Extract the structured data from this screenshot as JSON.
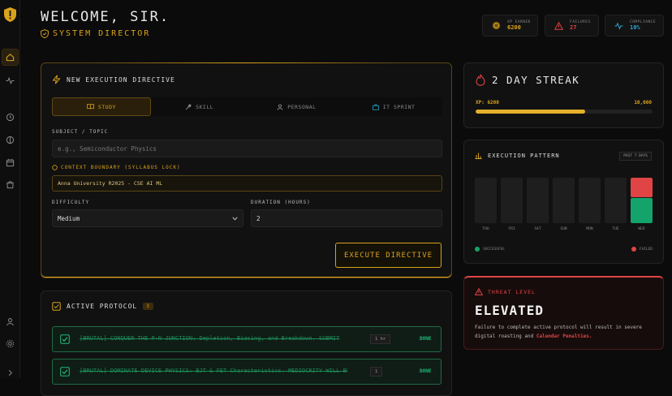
{
  "header": {
    "title": "WELCOME, SIR.",
    "subtitle": "SYSTEM DIRECTOR"
  },
  "stats": [
    {
      "label": "XP EARNED",
      "value": "6200",
      "color": "#d9a21b",
      "icon": "coin-icon"
    },
    {
      "label": "FAILURES",
      "value": "27",
      "color": "#e04444",
      "icon": "warning-icon"
    },
    {
      "label": "COMPLIANCE",
      "value": "10%",
      "color": "#2aa6c9",
      "icon": "pulse-icon"
    }
  ],
  "directive": {
    "title": "NEW EXECUTION DIRECTIVE",
    "tabs": [
      "STUDY",
      "SKILL",
      "PERSONAL",
      "IT SPRINT"
    ],
    "active_tab": "STUDY",
    "subject_label": "SUBJECT / TOPIC",
    "subject_placeholder": "e.g., Semiconductor Physics",
    "boundary_label": "CONTEXT BOUNDARY (SYLLABUS LOCK)",
    "boundary_value": "Anna University R2025 - CSE AI ML",
    "difficulty_label": "DIFFICULTY",
    "difficulty_value": "Medium",
    "duration_label": "DURATION (HOURS)",
    "duration_value": "2",
    "execute_label": "EXECUTE DIRECTIVE"
  },
  "protocol": {
    "title": "ACTIVE PROTOCOL",
    "count": "3",
    "tasks": [
      {
        "text": "[BRUTAL] CONQUER THE P-N JUNCTION: Depletion, Biasing, and Breakdown. SUBMIT",
        "duration": "1 hr",
        "status": "DONE"
      },
      {
        "text": "[BRUTAL] DOMINATE DEVICE PHYSICS: BJT & FET Characteristics. MEDIOCRITY WILL BE",
        "duration": "1",
        "status": "DONE"
      }
    ]
  },
  "streak": {
    "title": "2 DAY STREAK",
    "xp_label": "XP: 6200",
    "xp_max": "10,000",
    "progress": 0.62
  },
  "pattern": {
    "title": "EXECUTION PATTERN",
    "range": "PAST 7 DAYS",
    "days": [
      "THU",
      "FRI",
      "SAT",
      "SUN",
      "MON",
      "TUE",
      "WED"
    ],
    "success": [
      0,
      0,
      0,
      0,
      0,
      0,
      0.55
    ],
    "failed": [
      0,
      0,
      0,
      0,
      0,
      0,
      0.45
    ],
    "legend_success": "SUCCESSFUL",
    "legend_failed": "FAILED",
    "success_color": "#14a36a",
    "failed_color": "#e04444"
  },
  "threat": {
    "label": "THREAT LEVEL",
    "level": "ELEVATED",
    "message": "Failure to complete active protocol will result in severe",
    "message2": "digital roasting and ",
    "highlight": "Calendar Penalties."
  }
}
